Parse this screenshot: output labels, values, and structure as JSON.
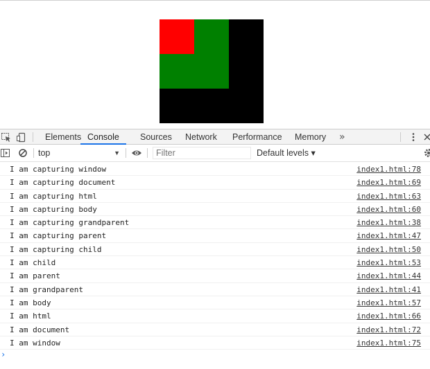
{
  "colors": {
    "outer_square": "#000000",
    "middle_square": "#008000",
    "inner_square": "#ff0000",
    "active_tab_underline": "#1a73e8"
  },
  "devtools": {
    "tabs": [
      {
        "label": "Elements"
      },
      {
        "label": "Console",
        "active": true
      },
      {
        "label": "Sources"
      },
      {
        "label": "Network"
      },
      {
        "label": "Performance"
      },
      {
        "label": "Memory"
      }
    ],
    "more_tabs_label": "»",
    "context_selector": "top",
    "filter_placeholder": "Filter",
    "default_levels_label": "Default levels ▾"
  },
  "console": {
    "messages": [
      {
        "text": "I am capturing window",
        "source": "index1.html:78"
      },
      {
        "text": "I am capturing document",
        "source": "index1.html:69"
      },
      {
        "text": "I am capturing html",
        "source": "index1.html:63"
      },
      {
        "text": "I am capturing body",
        "source": "index1.html:60"
      },
      {
        "text": "I am capturing grandparent",
        "source": "index1.html:38"
      },
      {
        "text": "I am capturing parent",
        "source": "index1.html:47"
      },
      {
        "text": "I am capturing child",
        "source": "index1.html:50"
      },
      {
        "text": "I am child",
        "source": "index1.html:53"
      },
      {
        "text": "I am parent",
        "source": "index1.html:44"
      },
      {
        "text": "I am grandparent",
        "source": "index1.html:41"
      },
      {
        "text": "I am body",
        "source": "index1.html:57"
      },
      {
        "text": "I am html",
        "source": "index1.html:66"
      },
      {
        "text": "I am document",
        "source": "index1.html:72"
      },
      {
        "text": "I am window",
        "source": "index1.html:75"
      }
    ],
    "prompt_symbol": "›"
  }
}
